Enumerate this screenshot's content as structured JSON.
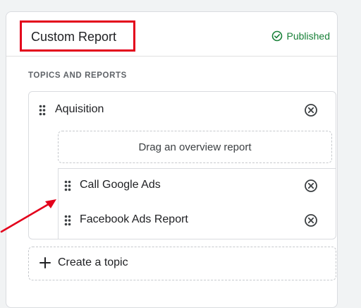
{
  "panel": {
    "title": "Custom Report",
    "status": "Published"
  },
  "section_label": "TOPICS AND REPORTS",
  "topic": {
    "label": "Aquisition",
    "dropzone": "Drag an overview report",
    "reports": [
      {
        "label": "Call Google Ads"
      },
      {
        "label": "Facebook Ads Report"
      }
    ]
  },
  "create_topic": {
    "label": "Create a topic"
  },
  "colors": {
    "highlight": "#e3001b",
    "published": "#188038"
  },
  "icons": {
    "status": "check-circle-icon",
    "drag": "drag-handle-icon",
    "remove": "close-circle-icon",
    "add": "plus-icon",
    "annotation": "red-arrow"
  }
}
